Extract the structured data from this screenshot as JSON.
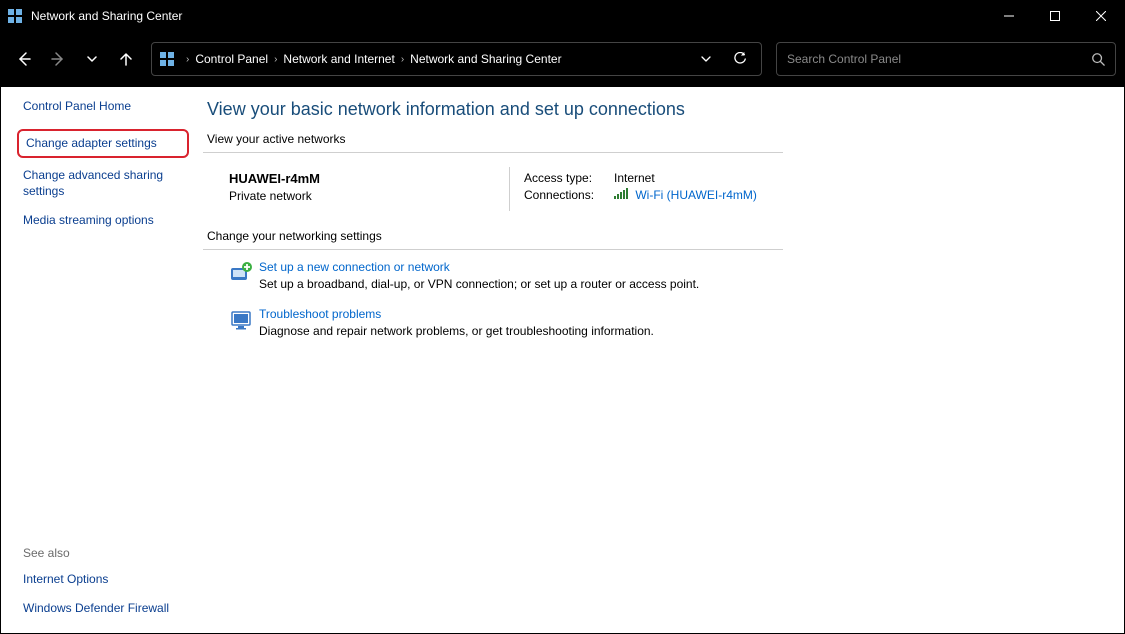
{
  "window": {
    "title": "Network and Sharing Center"
  },
  "breadcrumb": {
    "root": "Control Panel",
    "mid": "Network and Internet",
    "leaf": "Network and Sharing Center"
  },
  "search": {
    "placeholder": "Search Control Panel"
  },
  "sidebar": {
    "home": "Control Panel Home",
    "change_adapter": "Change adapter settings",
    "change_advanced": "Change advanced sharing settings",
    "media_streaming": "Media streaming options",
    "see_also_label": "See also",
    "internet_options": "Internet Options",
    "firewall": "Windows Defender Firewall"
  },
  "content": {
    "heading": "View your basic network information and set up connections",
    "active_label": "View your active networks",
    "network": {
      "name": "HUAWEI-r4mM",
      "type": "Private network",
      "access_key": "Access type:",
      "access_val": "Internet",
      "conn_key": "Connections:",
      "conn_val": "Wi-Fi (HUAWEI-r4mM)"
    },
    "change_label": "Change your networking settings",
    "setup": {
      "title": "Set up a new connection or network",
      "desc": "Set up a broadband, dial-up, or VPN connection; or set up a router or access point."
    },
    "troubleshoot": {
      "title": "Troubleshoot problems",
      "desc": "Diagnose and repair network problems, or get troubleshooting information."
    }
  }
}
